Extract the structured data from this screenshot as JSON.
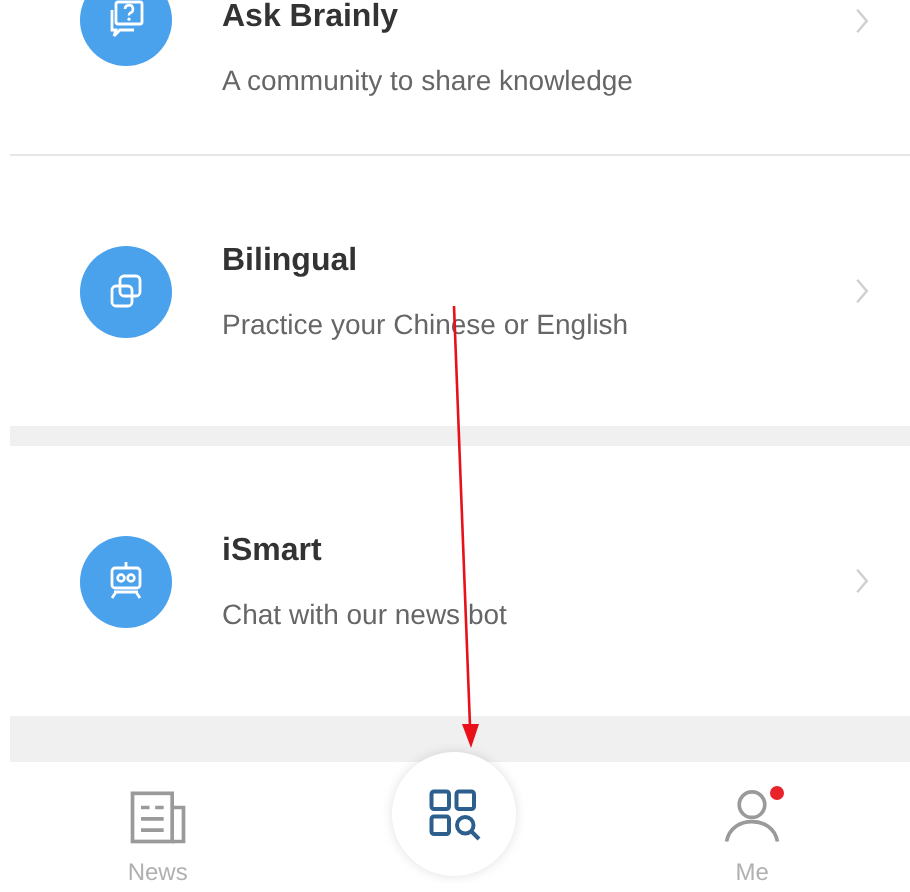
{
  "items": [
    {
      "title": "Ask Brainly",
      "subtitle": "A community to share knowledge",
      "kind": "question"
    },
    {
      "title": "Bilingual",
      "subtitle": "Practice your Chinese or English",
      "kind": "squares"
    },
    {
      "title": "iSmart",
      "subtitle": "Chat with our news bot",
      "kind": "robot"
    }
  ],
  "tab_bar": {
    "tabs": [
      {
        "label": "News",
        "kind": "news",
        "selected": false,
        "badge": false
      },
      {
        "label": "Me",
        "kind": "person",
        "selected": false,
        "badge": true
      }
    ]
  },
  "annotation": {
    "kind": "arrow"
  }
}
